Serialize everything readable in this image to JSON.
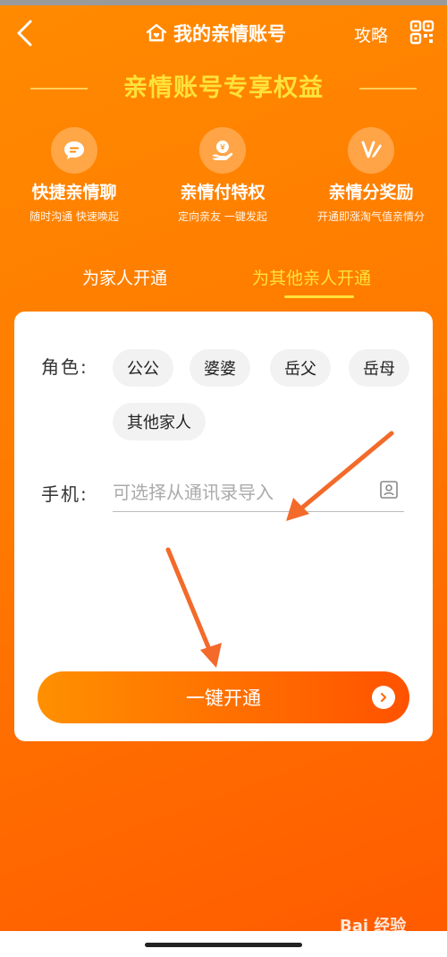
{
  "header": {
    "title": "我的亲情账号",
    "guide_label": "攻略"
  },
  "banner": {
    "title": "亲情账号专享权益"
  },
  "benefits": [
    {
      "title": "快捷亲情聊",
      "subtitle": "随时沟通 快速唤起",
      "icon": "chat-icon"
    },
    {
      "title": "亲情付特权",
      "subtitle": "定向亲友 一键发起",
      "icon": "payment-hand-icon"
    },
    {
      "title": "亲情分奖励",
      "subtitle": "开通即涨淘气值亲情分",
      "icon": "reward-pen-icon"
    }
  ],
  "tabs": [
    {
      "label": "为家人开通",
      "active": false
    },
    {
      "label": "为其他亲人开通",
      "active": true
    }
  ],
  "form": {
    "role_label": "角色:",
    "roles": [
      "公公",
      "婆婆",
      "岳父",
      "岳母",
      "其他家人"
    ],
    "phone_label": "手机:",
    "phone_placeholder": "可选择从通讯录导入",
    "phone_value": ""
  },
  "submit": {
    "label": "一键开通"
  },
  "watermark": "Bai 经验",
  "colors": {
    "accent": "#ff7a00",
    "highlight": "#ffe23a"
  }
}
